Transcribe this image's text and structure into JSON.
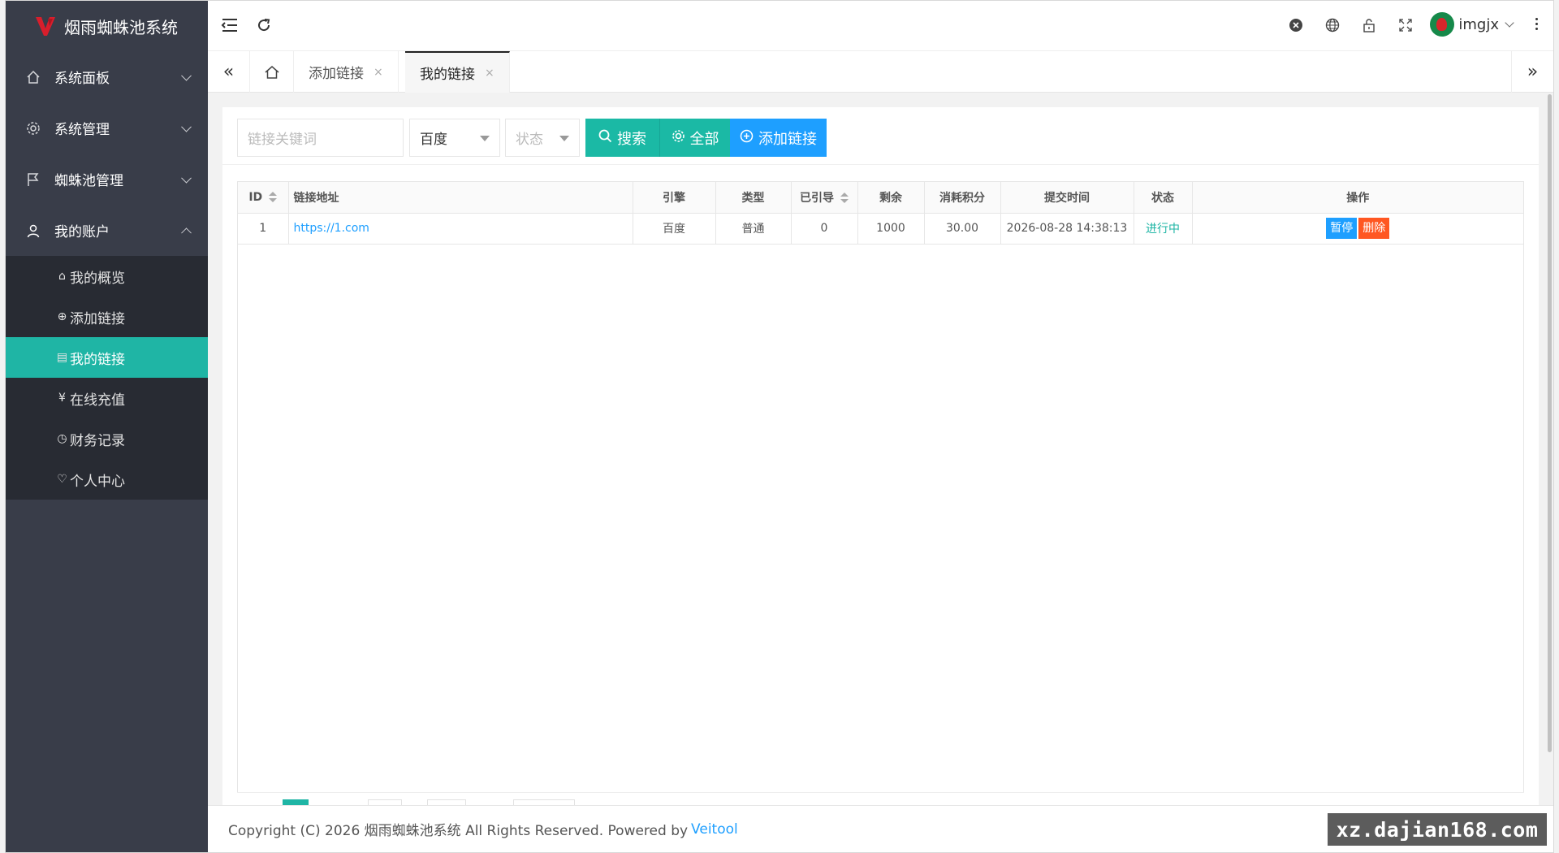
{
  "app": {
    "title": "烟雨蜘蛛池系统"
  },
  "sidebar": {
    "items": [
      {
        "label": "系统面板",
        "icon": "home-icon"
      },
      {
        "label": "系统管理",
        "icon": "gear-icon"
      },
      {
        "label": "蜘蛛池管理",
        "icon": "flag-icon"
      },
      {
        "label": "我的账户",
        "icon": "user-icon"
      }
    ],
    "sub_items": [
      {
        "label": "我的概览",
        "glyph": "⌂"
      },
      {
        "label": "添加链接",
        "glyph": "⊕"
      },
      {
        "label": "我的链接",
        "glyph": "▤",
        "active": true
      },
      {
        "label": "在线充值",
        "glyph": "¥"
      },
      {
        "label": "财务记录",
        "glyph": "◷"
      },
      {
        "label": "个人中心",
        "glyph": "♡"
      }
    ]
  },
  "header": {
    "username": "imgjx"
  },
  "tabs": [
    {
      "label": "添加链接",
      "close": "×"
    },
    {
      "label": "我的链接",
      "close": "×",
      "active": true
    }
  ],
  "toolbar": {
    "keyword_placeholder": "链接关键词",
    "engine_value": "百度",
    "status_placeholder": "状态",
    "search_label": "搜索",
    "all_label": "全部",
    "add_label": "添加链接"
  },
  "table": {
    "headers": [
      "ID",
      "链接地址",
      "引擎",
      "类型",
      "已引导",
      "剩余",
      "消耗积分",
      "提交时间",
      "状态",
      "操作"
    ],
    "rows": [
      {
        "id": "1",
        "url": "https://1.com",
        "engine": "百度",
        "type": "普通",
        "guided": "0",
        "remaining": "1000",
        "points": "30.00",
        "time": "2026-08-28 14:38:13",
        "status": "进行中",
        "pause": "暂停",
        "delete": "删除"
      }
    ]
  },
  "footer": {
    "copyright": "Copyright (C) 2026 烟雨蜘蛛池系统 All Rights Reserved. Powered by",
    "powered": "Veitool"
  },
  "watermark": "xz.dajian168.com",
  "colors": {
    "sidebar": "#393d49",
    "sidebar_dark": "#282b33",
    "accent": "#1fb5a5",
    "blue": "#1e9fff",
    "danger": "#ff5722",
    "button_teal": "#1bb9a5"
  }
}
